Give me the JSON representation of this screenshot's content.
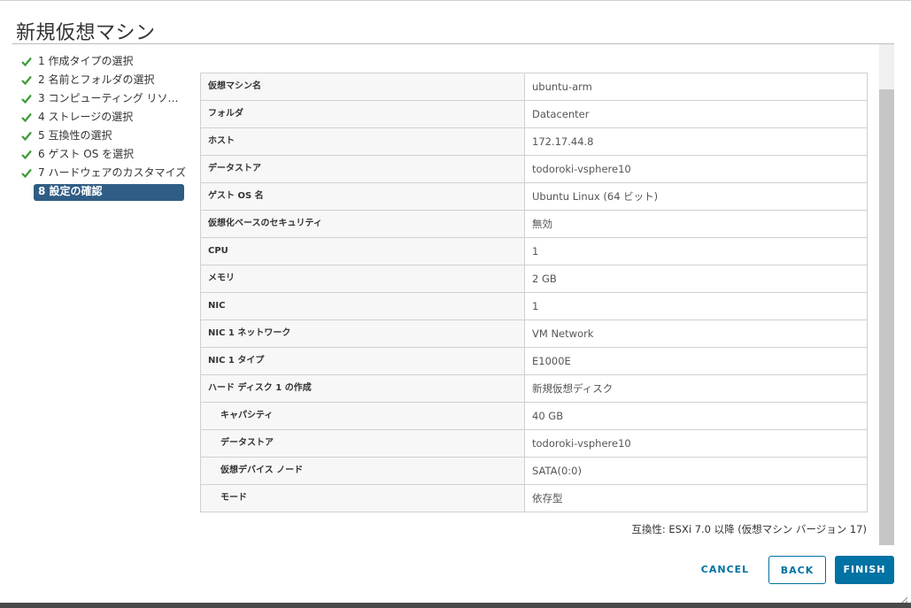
{
  "dialog": {
    "title": "新規仮想マシン"
  },
  "steps": [
    {
      "label": "1 作成タイプの選択",
      "done": true
    },
    {
      "label": "2 名前とフォルダの選択",
      "done": true
    },
    {
      "label": "3 コンピューティング リソー...",
      "done": true
    },
    {
      "label": "4 ストレージの選択",
      "done": true
    },
    {
      "label": "5 互換性の選択",
      "done": true
    },
    {
      "label": "6 ゲスト OS を選択",
      "done": true
    },
    {
      "label": "7 ハードウェアのカスタマイズ",
      "done": true
    },
    {
      "label": "8 設定の確認",
      "current": true
    }
  ],
  "summary": [
    {
      "key": "仮想マシン名",
      "value": "ubuntu-arm"
    },
    {
      "key": "フォルダ",
      "value": "Datacenter"
    },
    {
      "key": "ホスト",
      "value": "172.17.44.8"
    },
    {
      "key": "データストア",
      "value": "todoroki-vsphere10"
    },
    {
      "key": "ゲスト OS 名",
      "value": "Ubuntu Linux (64 ビット)"
    },
    {
      "key": "仮想化ベースのセキュリティ",
      "value": "無効"
    },
    {
      "key": "CPU",
      "value": "1"
    },
    {
      "key": "メモリ",
      "value": "2 GB"
    },
    {
      "key": "NIC",
      "value": "1"
    },
    {
      "key": "NIC 1 ネットワーク",
      "value": "VM Network"
    },
    {
      "key": "NIC 1 タイプ",
      "value": "E1000E"
    },
    {
      "key": "ハード ディスク 1 の作成",
      "value": "新規仮想ディスク"
    },
    {
      "key": "キャパシティ",
      "value": "40 GB",
      "indent": true
    },
    {
      "key": "データストア",
      "value": "todoroki-vsphere10",
      "indent": true
    },
    {
      "key": "仮想デバイス ノード",
      "value": "SATA(0:0)",
      "indent": true
    },
    {
      "key": "モード",
      "value": "依存型",
      "indent": true
    }
  ],
  "compatibility": "互換性: ESXi 7.0 以降 (仮想マシン バージョン 17)",
  "buttons": {
    "cancel": "CANCEL",
    "back": "BACK",
    "finish": "FINISH"
  },
  "colors": {
    "accent": "#0072a3",
    "check": "#3d9b35",
    "current_step_bg": "#2f5d85"
  },
  "icons": {
    "step_done": "check-icon",
    "resize": "resize-grip-icon"
  }
}
